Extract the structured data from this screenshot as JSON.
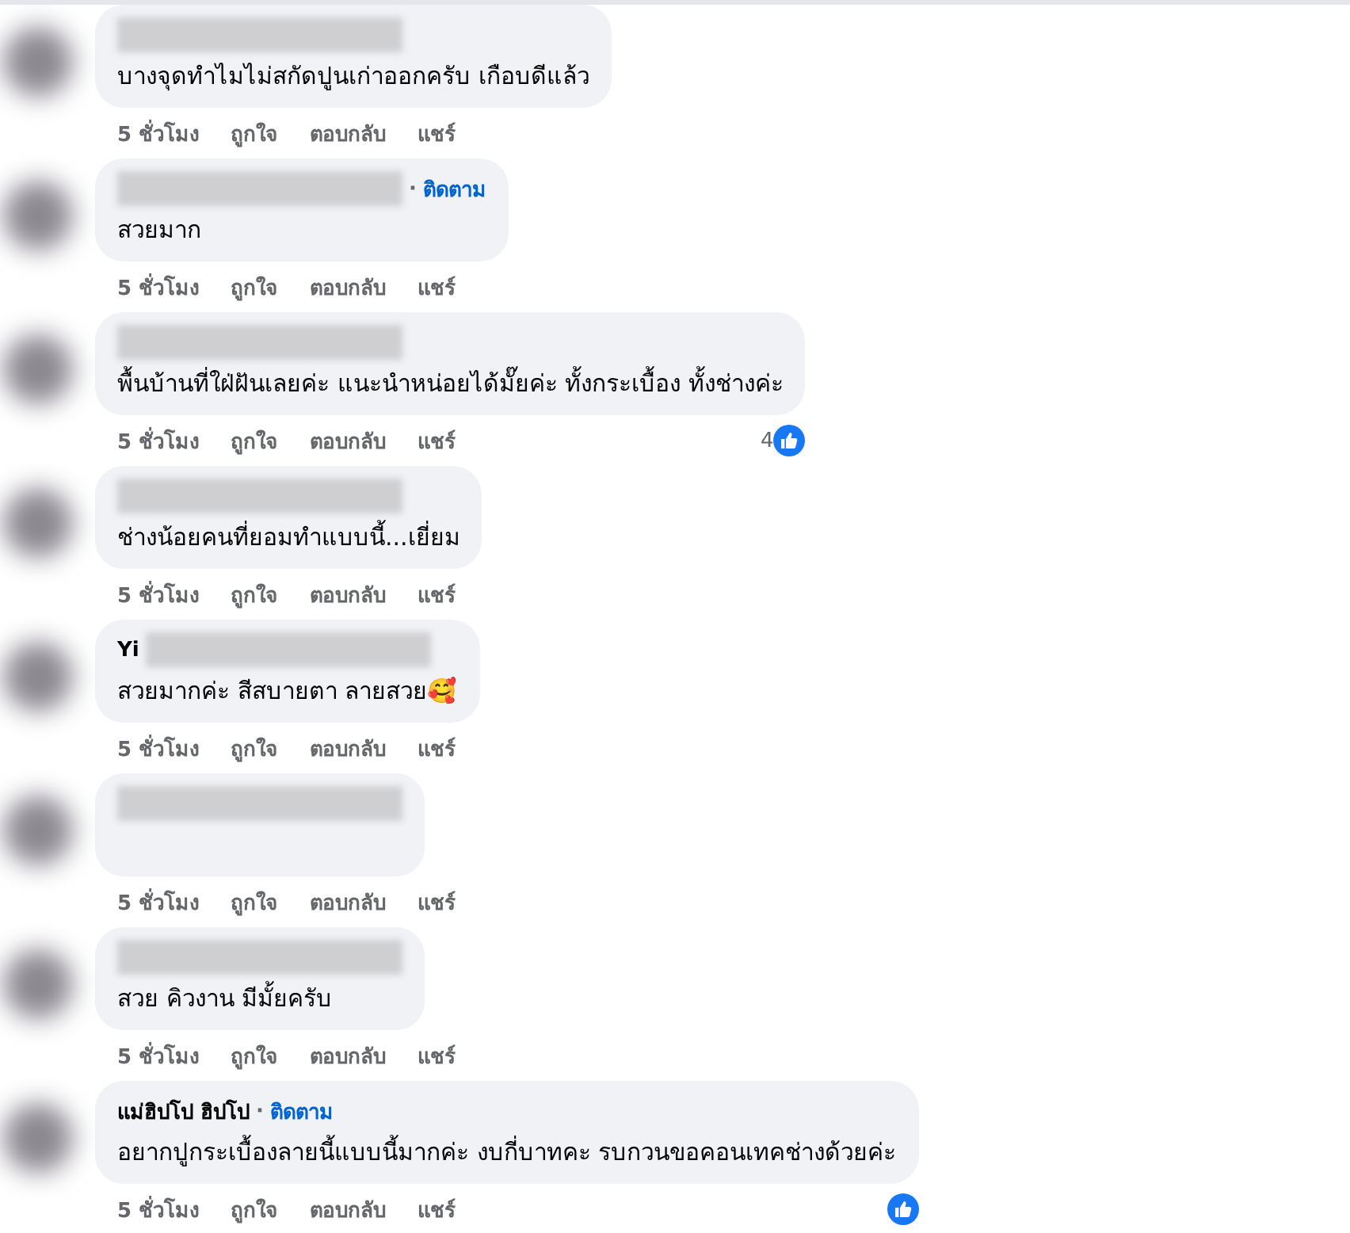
{
  "comments": [
    {
      "author_redacted": true,
      "text": "บางจุดทำไมไม่สกัดปูนเก่าออกครับ เกือบดีแล้ว",
      "actions": [
        "5 ชั่วโมง",
        "ถูกใจ",
        "ตอบกลับ",
        "แชร์"
      ]
    },
    {
      "author_redacted": true,
      "follow_separator": "·",
      "follow": "ติดตาม",
      "text": "สวยมาก",
      "actions": [
        "5 ชั่วโมง",
        "ถูกใจ",
        "ตอบกลับ",
        "แชร์"
      ]
    },
    {
      "author_redacted": true,
      "text": "พื้นบ้านที่ใฝ่ฝันเลยค่ะ แนะนำหน่อยได้มั๊ยค่ะ ทั้งกระเบื้อง ทั้งช่างค่ะ",
      "actions": [
        "5 ชั่วโมง",
        "ถูกใจ",
        "ตอบกลับ",
        "แชร์"
      ],
      "reaction": true,
      "reaction_count": "4"
    },
    {
      "author_redacted": true,
      "text": "ช่างน้อยคนที่ยอมทำแบบนี้...เยี่ยม",
      "actions": [
        "5 ชั่วโมง",
        "ถูกใจ",
        "ตอบกลับ",
        "แชร์"
      ]
    },
    {
      "author": "Yi",
      "author_redacted": true,
      "text": "สวยมากค่ะ สีสบายตา ลายสวย🥰",
      "actions": [
        "5 ชั่วโมง",
        "ถูกใจ",
        "ตอบกลับ",
        "แชร์"
      ]
    },
    {
      "author_redacted": true,
      "actions": [
        "5 ชั่วโมง",
        "ถูกใจ",
        "ตอบกลับ",
        "แชร์"
      ]
    },
    {
      "author_redacted": true,
      "text": "สวย คิวงาน มีมั้ยครับ",
      "actions": [
        "5 ชั่วโมง",
        "ถูกใจ",
        "ตอบกลับ",
        "แชร์"
      ]
    },
    {
      "author": "แม่ฮิปโป ฮิปโป",
      "follow_separator": "·",
      "follow": "ติดตาม",
      "text": "อยากปูกระเบื้องลายนี้แบบนี้มากค่ะ งบกี่บาทคะ รบกวนขอคอนเทคช่างด้วยค่ะ",
      "actions": [
        "5 ชั่วโมง",
        "ถูกใจ",
        "ตอบกลับ",
        "แชร์"
      ],
      "reaction": true
    }
  ]
}
